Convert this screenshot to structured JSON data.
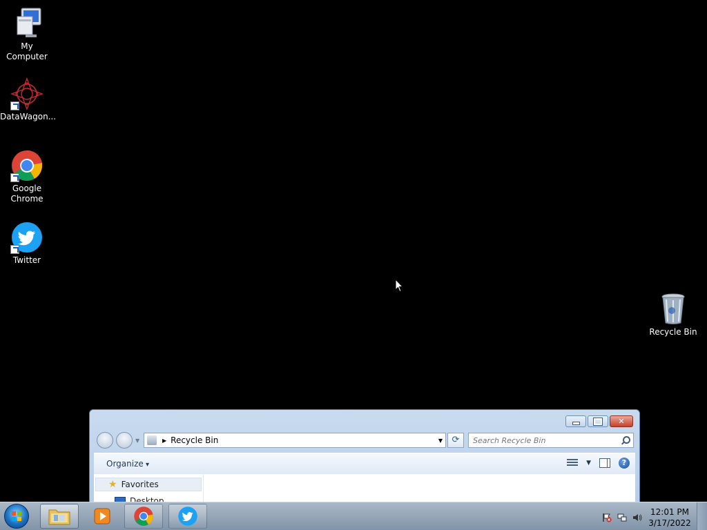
{
  "desktop": {
    "icons": [
      {
        "label": "My Computer",
        "icon": "computer-icon"
      },
      {
        "label": "DataWagon...",
        "icon": "datawagon-icon"
      },
      {
        "label": "Google Chrome",
        "icon": "chrome-icon"
      },
      {
        "label": "Twitter",
        "icon": "twitter-icon"
      },
      {
        "label": "Recycle Bin",
        "icon": "recycle-bin-icon"
      }
    ]
  },
  "explorer": {
    "address": "Recycle Bin",
    "search_placeholder": "Search Recycle Bin",
    "toolbar": {
      "organize_label": "Organize",
      "help_label": "?"
    },
    "navpane": {
      "favorites_label": "Favorites",
      "desktop_label": "Desktop"
    }
  },
  "taskbar": {
    "buttons": [
      {
        "name": "explorer",
        "icon": "folder-icon",
        "state": "active"
      },
      {
        "name": "media-player",
        "icon": "media-player-icon",
        "state": "idle"
      },
      {
        "name": "chrome",
        "icon": "chrome-icon",
        "state": "running"
      },
      {
        "name": "twitter",
        "icon": "twitter-icon",
        "state": "running"
      }
    ],
    "clock": {
      "time": "12:01 PM",
      "date": "3/17/2022"
    }
  },
  "colors": {
    "desktop_bg": "#000000",
    "taskbar": "#8194a8",
    "window_frame": "#b6cde8",
    "close_button": "#c6402b"
  }
}
